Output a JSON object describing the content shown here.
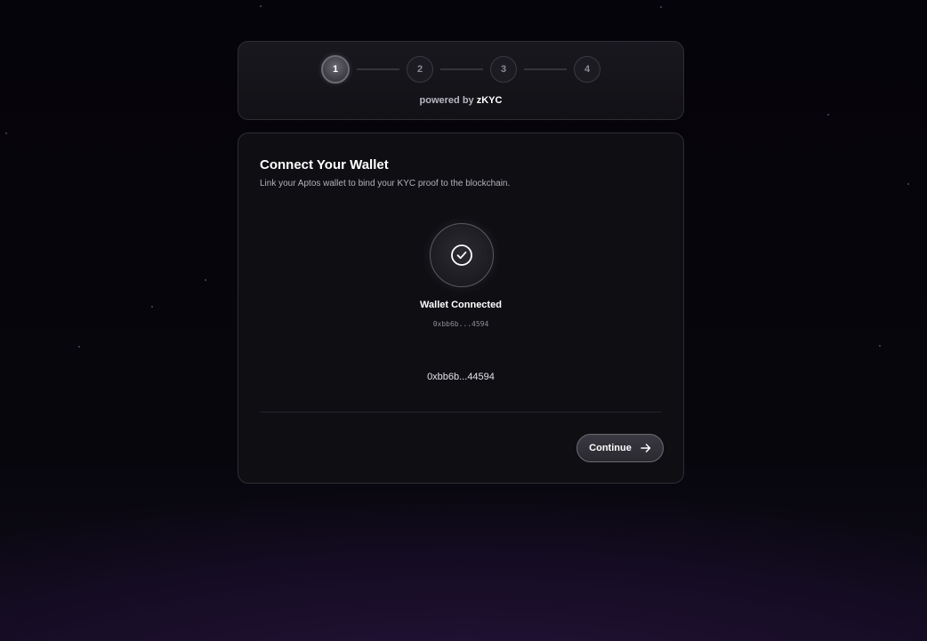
{
  "stepper": {
    "steps": [
      {
        "label": "1",
        "active": true
      },
      {
        "label": "2",
        "active": false
      },
      {
        "label": "3",
        "active": false
      },
      {
        "label": "4",
        "active": false
      }
    ],
    "powered_prefix": "powered by",
    "powered_brand": "zKYC"
  },
  "card": {
    "title": "Connect Your Wallet",
    "subtitle": "Link your Aptos wallet to bind your KYC proof to the blockchain.",
    "status_icon": "check-circle-icon",
    "status": "Wallet Connected",
    "address_short": "0xbb6b...4594",
    "address_display": "0xbb6b...44594",
    "continue_label": "Continue",
    "continue_icon": "arrow-right-icon"
  },
  "colors": {
    "background": "#05040a",
    "card": "#0f0e13",
    "border": "#2e2d35",
    "glow": "#2a1640"
  }
}
